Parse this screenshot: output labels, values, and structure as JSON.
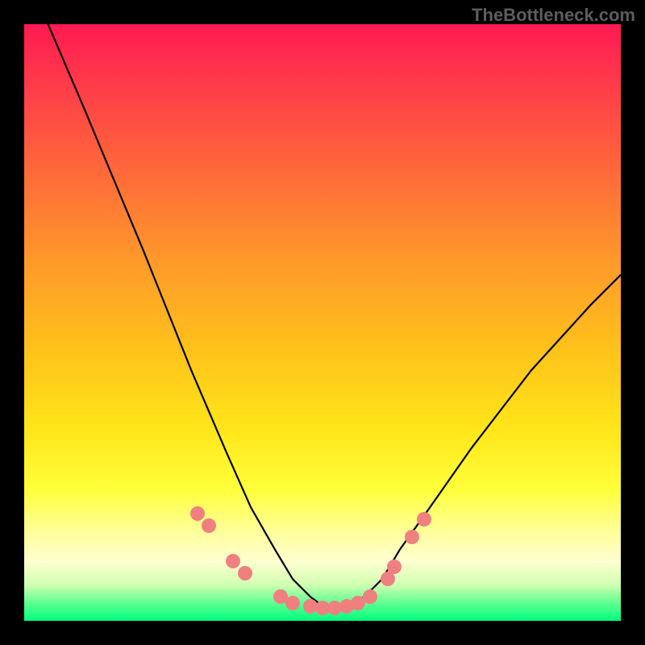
{
  "watermark": "TheBottleneck.com",
  "chart_data": {
    "type": "line",
    "title": "",
    "xlabel": "",
    "ylabel": "",
    "xlim": [
      0,
      100
    ],
    "ylim": [
      0,
      100
    ],
    "grid": false,
    "legend": false,
    "series": [
      {
        "name": "curve",
        "color": "#000000",
        "x": [
          4,
          10,
          20,
          28,
          34,
          38,
          42,
          45,
          48,
          50,
          52,
          54,
          57,
          60,
          63,
          68,
          75,
          85,
          95,
          100
        ],
        "y": [
          100,
          86,
          62,
          42,
          28,
          19,
          12,
          7,
          4,
          2.5,
          2,
          2.5,
          4,
          7,
          12,
          19,
          29,
          42,
          53,
          58
        ]
      }
    ],
    "markers": {
      "name": "highlight-points",
      "color": "#f08080",
      "x": [
        29,
        31,
        35,
        37,
        43,
        45,
        48,
        50,
        52,
        54,
        56,
        58,
        61,
        62,
        65,
        67
      ],
      "y": [
        18,
        16,
        10,
        8,
        4,
        3,
        2.5,
        2.2,
        2.2,
        2.5,
        3,
        4,
        7,
        9,
        14,
        17
      ]
    }
  }
}
